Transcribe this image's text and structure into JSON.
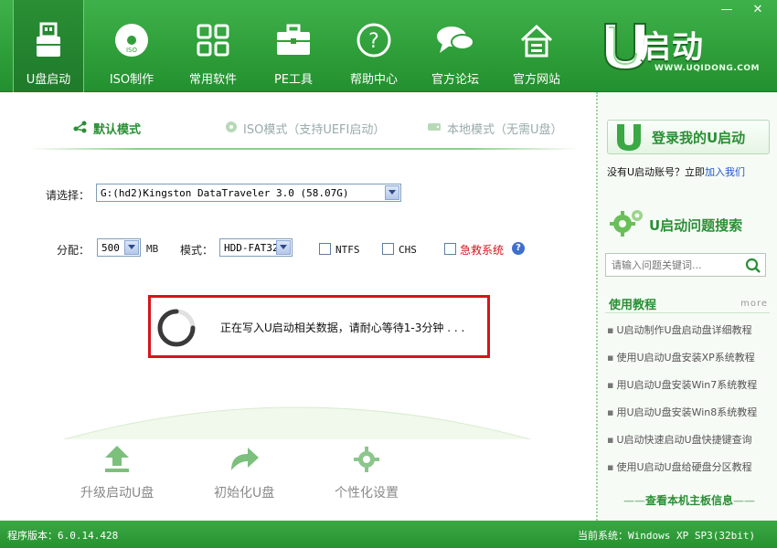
{
  "window": {
    "minimize": "—",
    "close": "✕"
  },
  "toolbar": {
    "items": [
      {
        "label": "U盘启动",
        "icon": "usb-icon"
      },
      {
        "label": "ISO制作",
        "icon": "disc-icon"
      },
      {
        "label": "常用软件",
        "icon": "grid-icon"
      },
      {
        "label": "PE工具",
        "icon": "toolbox-icon"
      },
      {
        "label": "帮助中心",
        "icon": "help-icon"
      },
      {
        "label": "官方论坛",
        "icon": "chat-icon"
      },
      {
        "label": "官方网站",
        "icon": "home-icon"
      }
    ],
    "active_index": 0
  },
  "logo": {
    "text": "启动",
    "url": "WWW.UQIDONG.COM"
  },
  "modes": {
    "default": "默认模式",
    "iso": "ISO模式（支持UEFI启动）",
    "local": "本地模式（无需U盘）"
  },
  "form": {
    "select_label": "请选择：",
    "device_value": "G:(hd2)Kingston DataTraveler 3.0 (58.07G)",
    "alloc_label": "分配：",
    "alloc_value": "500",
    "alloc_unit": "MB",
    "mode_label": "模式：",
    "mode_value": "HDD-FAT32",
    "ntfs_label": "NTFS",
    "chs_label": "CHS",
    "rescue_label": "急救系统",
    "help_glyph": "?"
  },
  "progress": {
    "message": "正在写入U启动相关数据，请耐心等待1-3分钟 . . ."
  },
  "actions": {
    "upgrade": "升级启动U盘",
    "init": "初始化U盘",
    "personalize": "个性化设置"
  },
  "side": {
    "login_button": "登录我的U启动",
    "no_account": "没有U启动账号？立即",
    "join_link": "加入我们",
    "search_title": "U启动问题搜索",
    "search_placeholder": "请输入问题关键词...",
    "tutorials_title": "使用教程",
    "more": "more",
    "tutorials": [
      "U启动制作U盘启动盘详细教程",
      "使用U启动U盘安装XP系统教程",
      "用U启动U盘安装Win7系统教程",
      "用U启动U盘安装Win8系统教程",
      "U启动快速启动U盘快捷键查询",
      "使用U启动U盘给硬盘分区教程"
    ],
    "mainboard_link": "查看本机主板信息"
  },
  "status": {
    "version": "程序版本：6.0.14.428",
    "system": "当前系统：Windows XP SP3(32bit)"
  },
  "colors": {
    "brand_green": "#2f9f3a",
    "alert_red": "#d6141a",
    "link_blue": "#1a56c9"
  }
}
